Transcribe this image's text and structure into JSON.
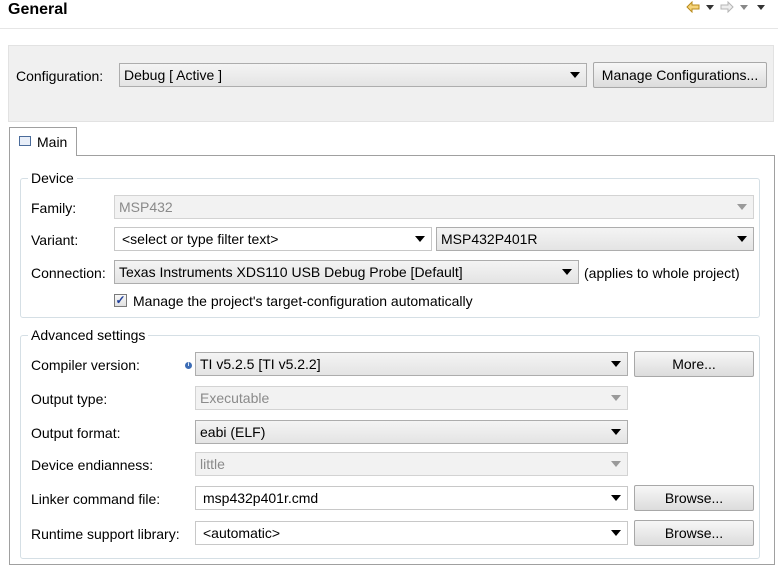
{
  "header": {
    "title": "General"
  },
  "icons": {
    "back": "back-arrow-icon",
    "forward": "forward-arrow-icon",
    "dropdown": "chevron-down-icon",
    "tab": "main-tab-icon",
    "info": "info-icon",
    "check": "checkmark-icon"
  },
  "configuration": {
    "label": "Configuration:",
    "value": "Debug  [ Active ]",
    "manage_button": "Manage Configurations..."
  },
  "tabs": [
    {
      "label": "Main",
      "selected": true
    }
  ],
  "device": {
    "group_title": "Device",
    "family": {
      "label": "Family:",
      "value": "MSP432",
      "enabled": false
    },
    "variant": {
      "label": "Variant:",
      "filter_value": "<select or type filter text>",
      "value": "MSP432P401R"
    },
    "connection": {
      "label": "Connection:",
      "value": "Texas Instruments XDS110 USB Debug Probe [Default]",
      "note": "(applies to whole project)"
    },
    "manage_target": {
      "label": "Manage the project's target-configuration automatically",
      "checked": true
    }
  },
  "advanced": {
    "group_title": "Advanced settings",
    "compiler_version": {
      "label": "Compiler version:",
      "value": "TI v5.2.5  [TI v5.2.2]",
      "button": "More..."
    },
    "output_type": {
      "label": "Output type:",
      "value": "Executable",
      "enabled": false
    },
    "output_format": {
      "label": "Output format:",
      "value": "eabi (ELF)"
    },
    "device_endianness": {
      "label": "Device endianness:",
      "value": "little",
      "enabled": false
    },
    "linker_command_file": {
      "label": "Linker command file:",
      "value": "msp432p401r.cmd",
      "button": "Browse..."
    },
    "runtime_support_library": {
      "label": "Runtime support library:",
      "value": "<automatic>",
      "button": "Browse..."
    }
  }
}
